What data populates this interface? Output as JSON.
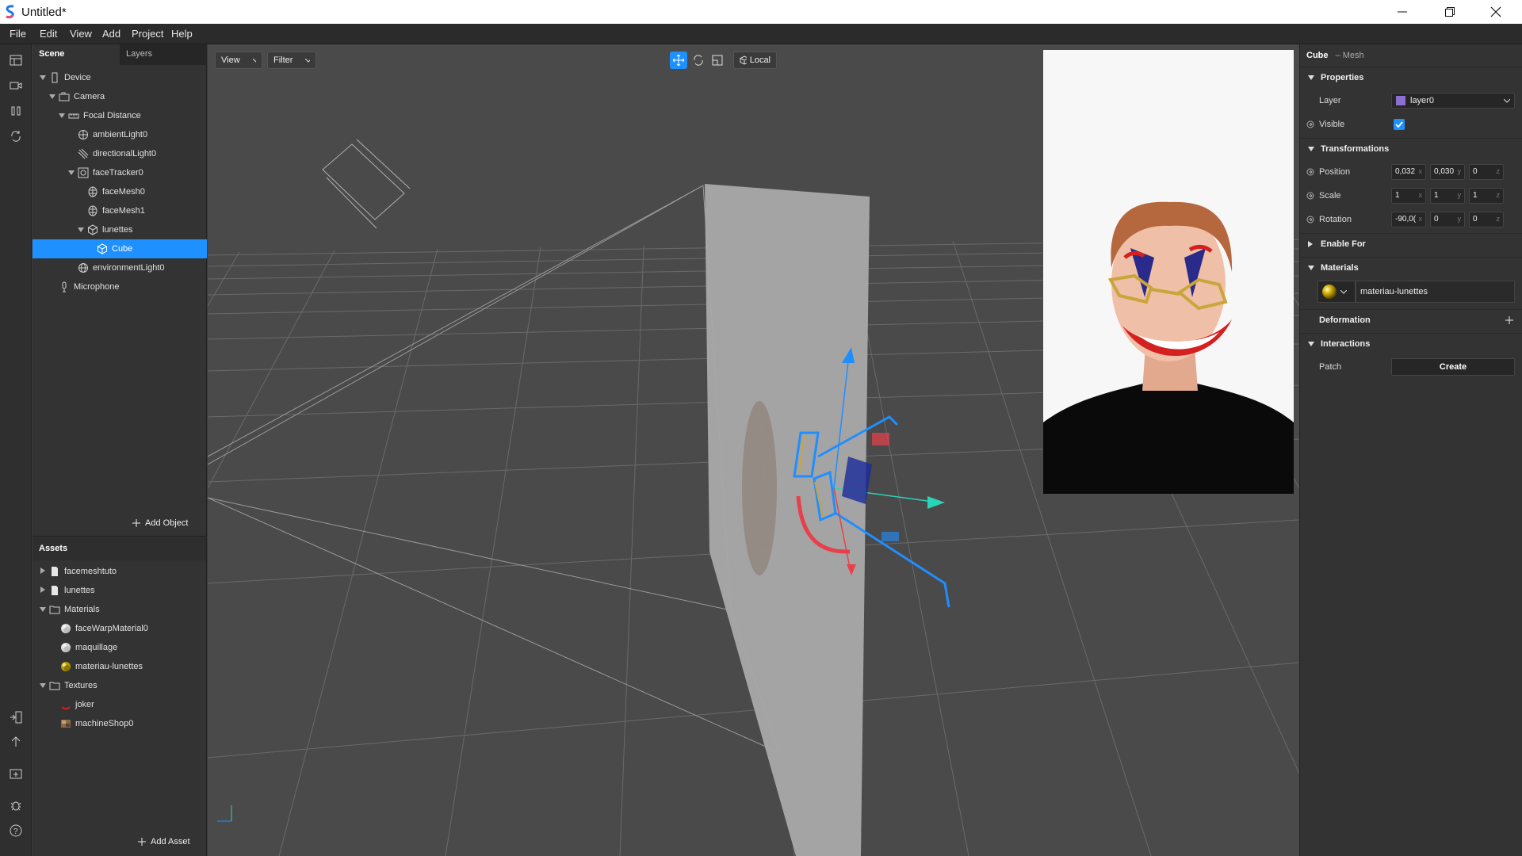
{
  "window": {
    "title": "Untitled*"
  },
  "menu": [
    "File",
    "Edit",
    "View",
    "Add",
    "Project",
    "Help"
  ],
  "scene_panel": {
    "tabs": [
      "Scene",
      "Layers"
    ],
    "tree": [
      {
        "label": "Device",
        "depth": 0,
        "arrow": "open",
        "icon": "device-icon"
      },
      {
        "label": "Camera",
        "depth": 1,
        "arrow": "open",
        "icon": "camera-icon"
      },
      {
        "label": "Focal Distance",
        "depth": 2,
        "arrow": "open",
        "icon": "focal-distance-icon"
      },
      {
        "label": "ambientLight0",
        "depth": 3,
        "arrow": "",
        "icon": "ambient-light-icon"
      },
      {
        "label": "directionalLight0",
        "depth": 3,
        "arrow": "",
        "icon": "directional-light-icon"
      },
      {
        "label": "faceTracker0",
        "depth": 3,
        "arrow": "open",
        "icon": "face-tracker-icon"
      },
      {
        "label": "faceMesh0",
        "depth": 4,
        "arrow": "",
        "icon": "face-mesh-icon"
      },
      {
        "label": "faceMesh1",
        "depth": 4,
        "arrow": "",
        "icon": "face-mesh-icon"
      },
      {
        "label": "lunettes",
        "depth": 4,
        "arrow": "open",
        "icon": "object-icon"
      },
      {
        "label": "Cube",
        "depth": 5,
        "arrow": "",
        "icon": "mesh-icon",
        "selected": true
      },
      {
        "label": "environmentLight0",
        "depth": 3,
        "arrow": "",
        "icon": "environment-light-icon"
      },
      {
        "label": "Microphone",
        "depth": 1,
        "arrow": "",
        "icon": "microphone-icon"
      }
    ],
    "add_object": "Add Object"
  },
  "assets_panel": {
    "title": "Assets",
    "tree": [
      {
        "label": "facemeshtuto",
        "depth": 0,
        "arrow": "closed",
        "icon": "file-icon"
      },
      {
        "label": "lunettes",
        "depth": 0,
        "arrow": "closed",
        "icon": "file-icon"
      },
      {
        "label": "Materials",
        "depth": 0,
        "arrow": "open",
        "icon": "folder-icon"
      },
      {
        "label": "faceWarpMaterial0",
        "depth": 1,
        "arrow": "",
        "icon": "material-sphere-gray-icon"
      },
      {
        "label": "maquillage",
        "depth": 1,
        "arrow": "",
        "icon": "material-sphere-gray-icon"
      },
      {
        "label": "materiau-lunettes",
        "depth": 1,
        "arrow": "",
        "icon": "material-sphere-gold-icon"
      },
      {
        "label": "Textures",
        "depth": 0,
        "arrow": "open",
        "icon": "folder-icon"
      },
      {
        "label": "joker",
        "depth": 1,
        "arrow": "",
        "icon": "texture-joker-icon"
      },
      {
        "label": "machineShop0",
        "depth": 1,
        "arrow": "",
        "icon": "texture-thumbnail-icon"
      }
    ],
    "add_asset": "Add Asset"
  },
  "viewport": {
    "view_label": "View",
    "filter_label": "Filter",
    "local_label": "Local"
  },
  "inspector": {
    "object_name": "Cube",
    "object_type": "– Mesh",
    "sections": {
      "properties": "Properties",
      "transformations": "Transformations",
      "enable_for": "Enable For",
      "materials": "Materials",
      "deformation": "Deformation",
      "interactions": "Interactions"
    },
    "layer_label": "Layer",
    "layer_value": "layer0",
    "layer_color": "#8a6fd1",
    "visible_label": "Visible",
    "visible_checked": true,
    "position_label": "Position",
    "position": [
      "0,032",
      "0,030",
      "0"
    ],
    "scale_label": "Scale",
    "scale": [
      "1",
      "1",
      "1"
    ],
    "rotation_label": "Rotation",
    "rotation": [
      "-90,0(",
      "0",
      "0"
    ],
    "axes": [
      "x",
      "y",
      "z"
    ],
    "material_value": "materiau-lunettes",
    "patch_label": "Patch",
    "create_label": "Create"
  },
  "colors": {
    "selection": "#1e90ff",
    "gizmo_y": "#1f8fff",
    "gizmo_x": "#2ad4b8",
    "gizmo_z": "#e8404a"
  }
}
